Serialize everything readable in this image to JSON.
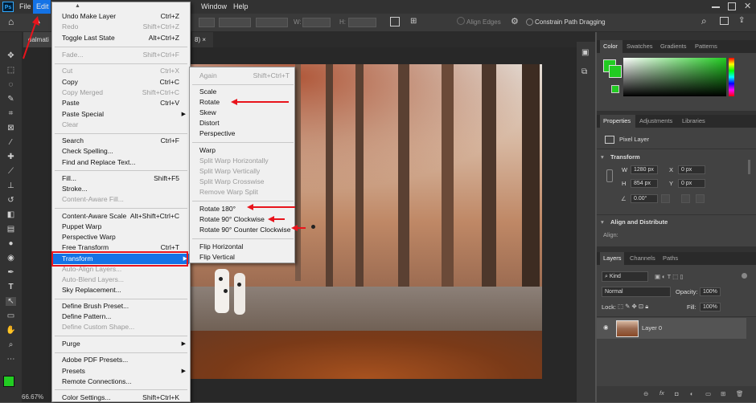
{
  "menubar": {
    "logo": "Ps",
    "items": [
      "File",
      "Edit",
      "Window",
      "Help"
    ]
  },
  "options_bar": {
    "w_label": "W:",
    "h_label": "H:",
    "align_edges": "Align Edges",
    "constrain": "Constrain Path Dragging"
  },
  "document": {
    "tab_title": "dalmati",
    "tab_suffix": "8) ×",
    "zoom": "66.67%"
  },
  "edit_menu": {
    "items": [
      {
        "label": "Undo Make Layer",
        "shortcut": "Ctrl+Z",
        "disabled": false
      },
      {
        "label": "Redo",
        "shortcut": "Shift+Ctrl+Z",
        "disabled": true
      },
      {
        "label": "Toggle Last State",
        "shortcut": "Alt+Ctrl+Z",
        "disabled": false
      },
      {
        "label": "Fade...",
        "shortcut": "Shift+Ctrl+F",
        "disabled": true
      },
      {
        "label": "Cut",
        "shortcut": "Ctrl+X",
        "disabled": true
      },
      {
        "label": "Copy",
        "shortcut": "Ctrl+C",
        "disabled": false
      },
      {
        "label": "Copy Merged",
        "shortcut": "Shift+Ctrl+C",
        "disabled": true
      },
      {
        "label": "Paste",
        "shortcut": "Ctrl+V",
        "disabled": false
      },
      {
        "label": "Paste Special",
        "shortcut": "",
        "disabled": false
      },
      {
        "label": "Clear",
        "shortcut": "",
        "disabled": true
      },
      {
        "label": "Search",
        "shortcut": "Ctrl+F",
        "disabled": false
      },
      {
        "label": "Check Spelling...",
        "shortcut": "",
        "disabled": false
      },
      {
        "label": "Find and Replace Text...",
        "shortcut": "",
        "disabled": false
      },
      {
        "label": "Fill...",
        "shortcut": "Shift+F5",
        "disabled": false
      },
      {
        "label": "Stroke...",
        "shortcut": "",
        "disabled": false
      },
      {
        "label": "Content-Aware Fill...",
        "shortcut": "",
        "disabled": true
      },
      {
        "label": "Content-Aware Scale",
        "shortcut": "Alt+Shift+Ctrl+C",
        "disabled": false
      },
      {
        "label": "Puppet Warp",
        "shortcut": "",
        "disabled": false
      },
      {
        "label": "Perspective Warp",
        "shortcut": "",
        "disabled": false
      },
      {
        "label": "Free Transform",
        "shortcut": "Ctrl+T",
        "disabled": false
      },
      {
        "label": "Transform",
        "shortcut": "",
        "disabled": false
      },
      {
        "label": "Auto-Align Layers...",
        "shortcut": "",
        "disabled": true
      },
      {
        "label": "Auto-Blend Layers...",
        "shortcut": "",
        "disabled": true
      },
      {
        "label": "Sky Replacement...",
        "shortcut": "",
        "disabled": false
      },
      {
        "label": "Define Brush Preset...",
        "shortcut": "",
        "disabled": false
      },
      {
        "label": "Define Pattern...",
        "shortcut": "",
        "disabled": false
      },
      {
        "label": "Define Custom Shape...",
        "shortcut": "",
        "disabled": true
      },
      {
        "label": "Purge",
        "shortcut": "",
        "disabled": false
      },
      {
        "label": "Adobe PDF Presets...",
        "shortcut": "",
        "disabled": false
      },
      {
        "label": "Presets",
        "shortcut": "",
        "disabled": false
      },
      {
        "label": "Remote Connections...",
        "shortcut": "",
        "disabled": false
      },
      {
        "label": "Color Settings...",
        "shortcut": "Shift+Ctrl+K",
        "disabled": false
      }
    ]
  },
  "transform_menu": {
    "items": [
      {
        "label": "Again",
        "shortcut": "Shift+Ctrl+T",
        "disabled": true
      },
      {
        "label": "Scale",
        "shortcut": "",
        "disabled": false
      },
      {
        "label": "Rotate",
        "shortcut": "",
        "disabled": false
      },
      {
        "label": "Skew",
        "shortcut": "",
        "disabled": false
      },
      {
        "label": "Distort",
        "shortcut": "",
        "disabled": false
      },
      {
        "label": "Perspective",
        "shortcut": "",
        "disabled": false
      },
      {
        "label": "Warp",
        "shortcut": "",
        "disabled": false
      },
      {
        "label": "Split Warp Horizontally",
        "shortcut": "",
        "disabled": true
      },
      {
        "label": "Split Warp Vertically",
        "shortcut": "",
        "disabled": true
      },
      {
        "label": "Split Warp Crosswise",
        "shortcut": "",
        "disabled": true
      },
      {
        "label": "Remove Warp Split",
        "shortcut": "",
        "disabled": true
      },
      {
        "label": "Rotate 180°",
        "shortcut": "",
        "disabled": false
      },
      {
        "label": "Rotate 90° Clockwise",
        "shortcut": "",
        "disabled": false
      },
      {
        "label": "Rotate 90° Counter Clockwise",
        "shortcut": "",
        "disabled": false
      },
      {
        "label": "Flip Horizontal",
        "shortcut": "",
        "disabled": false
      },
      {
        "label": "Flip Vertical",
        "shortcut": "",
        "disabled": false
      }
    ]
  },
  "color_panel": {
    "tabs": [
      "Color",
      "Swatches",
      "Gradients",
      "Patterns"
    ],
    "foreground": "#22cc22"
  },
  "properties_panel": {
    "tabs": [
      "Properties",
      "Adjustments",
      "Libraries"
    ],
    "layer_type": "Pixel Layer",
    "transform_title": "Transform",
    "w_label": "W",
    "w_value": "1280 px",
    "h_label": "H",
    "h_value": "854 px",
    "x_label": "X",
    "x_value": "0 px",
    "y_label": "Y",
    "y_value": "0 px",
    "angle_value": "0.00°",
    "align_title": "Align and Distribute",
    "align_label": "Align:"
  },
  "layers_panel": {
    "tabs": [
      "Layers",
      "Channels",
      "Paths"
    ],
    "kind": "Kind",
    "blend_mode": "Normal",
    "opacity_label": "Opacity:",
    "opacity_value": "100%",
    "lock_label": "Lock:",
    "fill_label": "Fill:",
    "fill_value": "100%",
    "layer_name": "Layer 0"
  },
  "colors": {
    "accent": "#1473e6",
    "annotation": "#e8141c"
  }
}
